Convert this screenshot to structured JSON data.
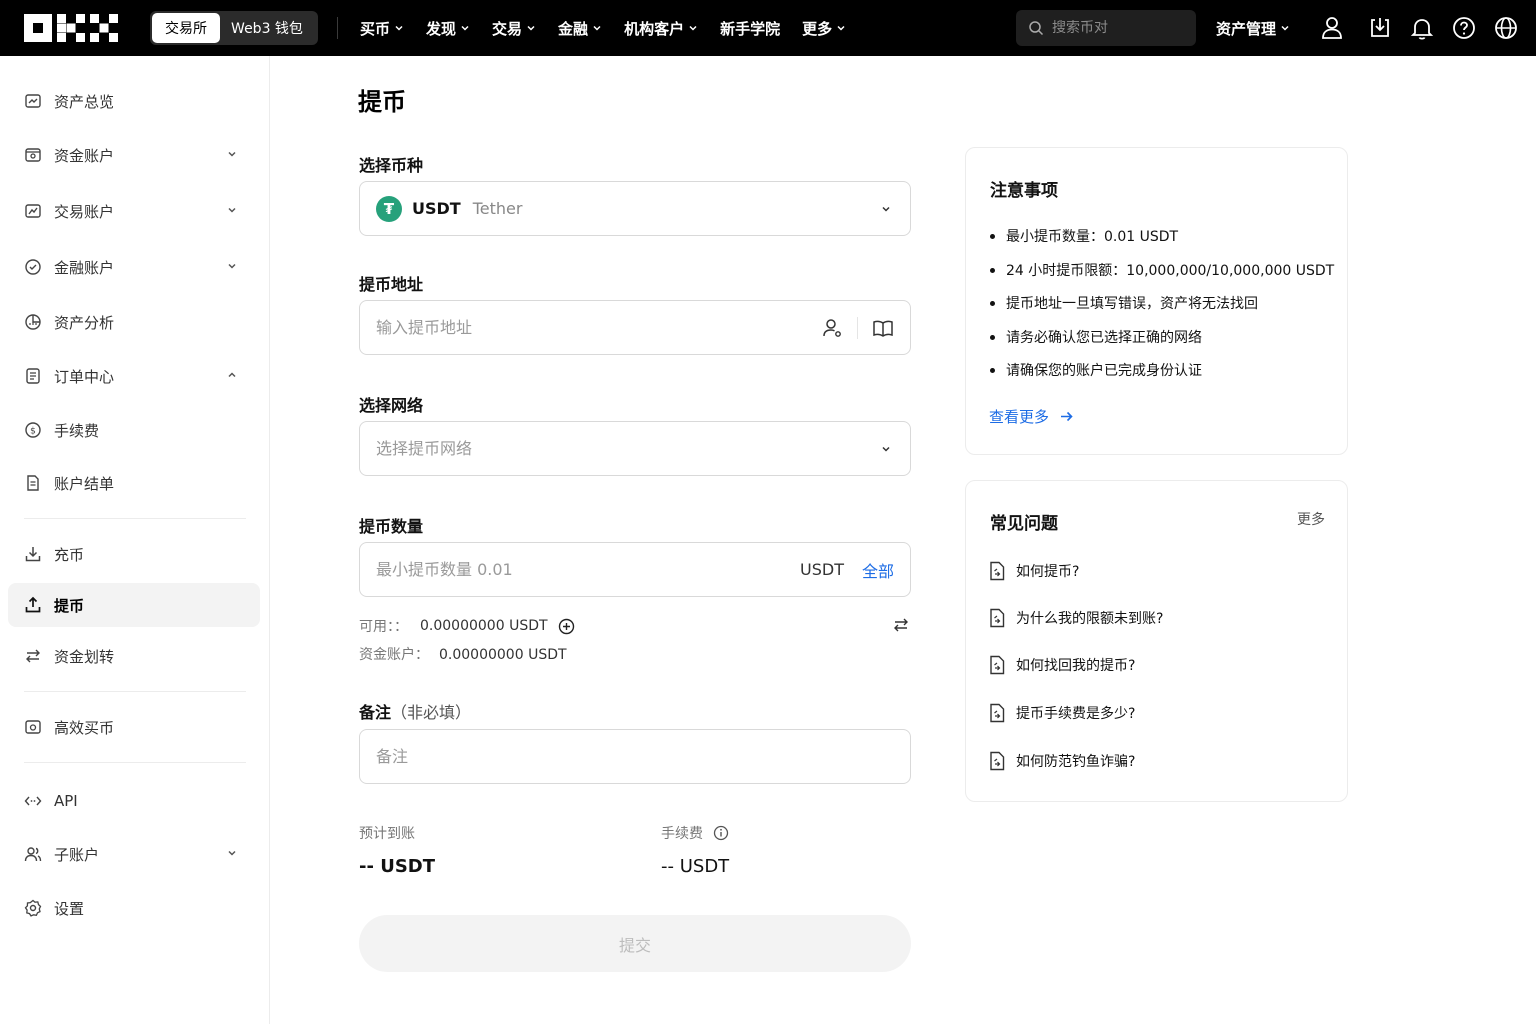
{
  "nav": {
    "switch_exchange": "交易所",
    "switch_web3": "Web3 钱包",
    "menu": [
      "买币",
      "发现",
      "交易",
      "金融",
      "机构客户",
      "新手学院",
      "更多"
    ],
    "search_placeholder": "搜索币对",
    "asset_mgmt": "资产管理"
  },
  "sidebar": {
    "items": [
      {
        "label": "资产总览",
        "icon": "dashboard-icon"
      },
      {
        "label": "资金账户",
        "icon": "wallet-icon"
      },
      {
        "label": "交易账户",
        "icon": "trade-chart-icon"
      },
      {
        "label": "金融账户",
        "icon": "finance-icon"
      },
      {
        "label": "资产分析",
        "icon": "pie-chart-icon"
      },
      {
        "label": "订单中心",
        "icon": "order-list-icon"
      },
      {
        "label": "手续费",
        "icon": "dollar-icon"
      },
      {
        "label": "账户结单",
        "icon": "statement-icon"
      },
      {
        "label": "充币",
        "icon": "deposit-icon"
      },
      {
        "label": "提币",
        "icon": "withdraw-icon"
      },
      {
        "label": "资金划转",
        "icon": "transfer-icon"
      },
      {
        "label": "高效买币",
        "icon": "buy-crypto-icon"
      },
      {
        "label": "API",
        "icon": "api-icon"
      },
      {
        "label": "子账户",
        "icon": "sub-account-icon"
      },
      {
        "label": "设置",
        "icon": "settings-icon"
      }
    ]
  },
  "main": {
    "title": "提币",
    "coin_label": "选择币种",
    "coin_code": "USDT",
    "coin_name": "Tether",
    "address_label": "提币地址",
    "address_placeholder": "输入提币地址",
    "network_label": "选择网络",
    "network_placeholder": "选择提币网络",
    "amount_label": "提币数量",
    "amount_placeholder": "最小提币数量 0.01",
    "amount_unit": "USDT",
    "amount_all": "全部",
    "available_key": "可用：：",
    "available_value": "0.00000000 USDT",
    "funding_key": "资金账户：",
    "funding_value": "0.00000000 USDT",
    "memo_label": "备注",
    "memo_optional": "（非必填）",
    "memo_placeholder": "备注",
    "receive_label": "预计到账",
    "receive_value": "-- USDT",
    "fee_label": "手续费",
    "fee_value": "-- USDT",
    "submit": "提交"
  },
  "notice": {
    "title": "注意事项",
    "items": [
      "最小提币数量：0.01 USDT",
      "24 小时提币限额：10,000,000/10,000,000 USDT",
      "提币地址一旦填写错误，资产将无法找回",
      "请务必确认您已选择正确的网络",
      "请确保您的账户已完成身份认证"
    ],
    "more": "查看更多"
  },
  "faq": {
    "title": "常见问题",
    "more": "更多",
    "items": [
      "如何提币?",
      "为什么我的限额未到账?",
      "如何找回我的提币?",
      "提币手续费是多少?",
      "如何防范钓鱼诈骗?"
    ]
  },
  "colors": {
    "accent": "#1d6ce5",
    "usdt": "#26a17b",
    "nav_bg": "#000000"
  }
}
